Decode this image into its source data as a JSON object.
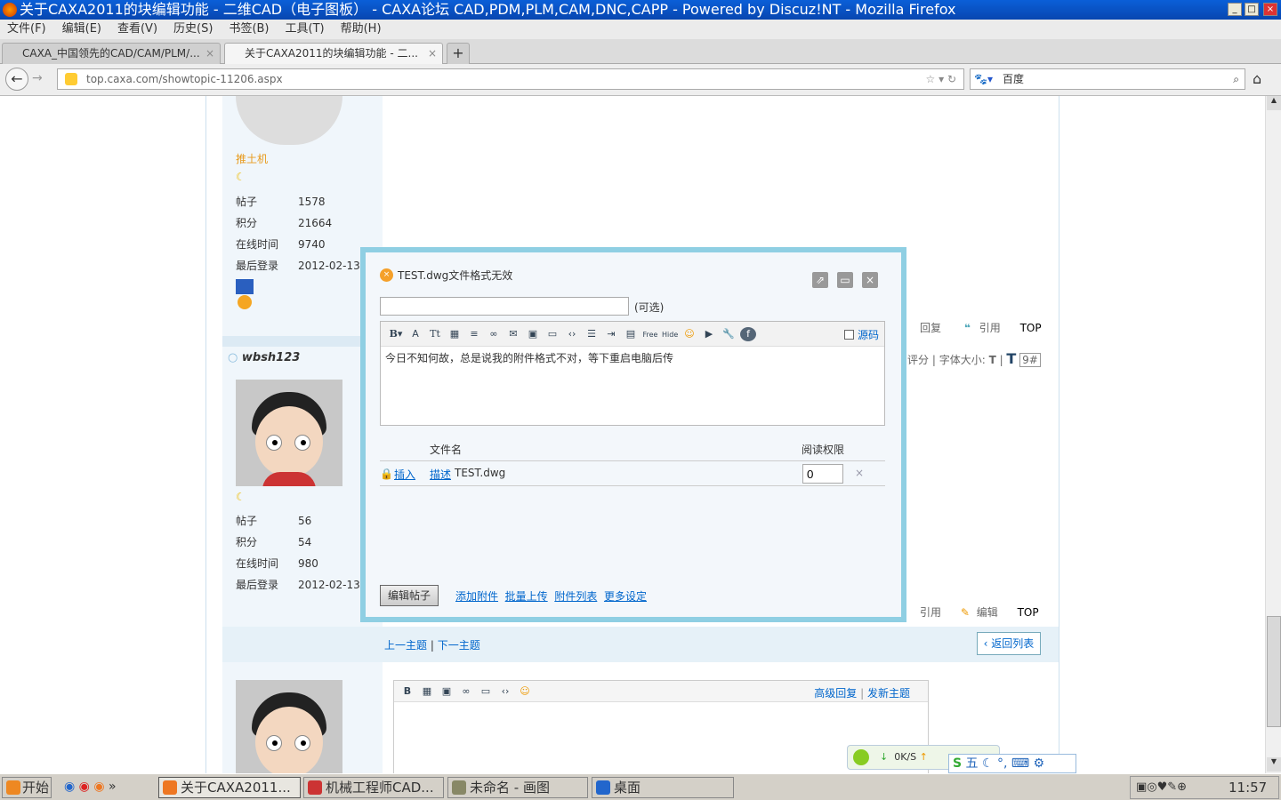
{
  "window": {
    "title": "关于CAXA2011的块编辑功能 - 二维CAD（电子图板） - CAXA论坛 CAD,PDM,PLM,CAM,DNC,CAPP - Powered by Discuz!NT - Mozilla Firefox",
    "min": "_",
    "max": "□",
    "close": "×"
  },
  "menu": [
    "文件(F)",
    "编辑(E)",
    "查看(V)",
    "历史(S)",
    "书签(B)",
    "工具(T)",
    "帮助(H)"
  ],
  "tabs": [
    {
      "label": "CAXA_中国领先的CAD/CAM/PLM/..."
    },
    {
      "label": "关于CAXA2011的块编辑功能 - 二..."
    }
  ],
  "new_tab": "+",
  "url": "top.caxa.com/showtopic-11206.aspx",
  "search_engine": "百度",
  "post1": {
    "user": "推土机",
    "stats": [
      {
        "label": "帖子",
        "value": "1578"
      },
      {
        "label": "积分",
        "value": "21664"
      },
      {
        "label": "在线时间",
        "value": "9740"
      },
      {
        "label": "最后登录",
        "value": "2012-02-13"
      }
    ],
    "actions": [
      "回复",
      "引用",
      "TOP"
    ]
  },
  "post2": {
    "user": "wbsh123",
    "bar": [
      "评分",
      "字体大小:",
      "T",
      "T",
      "9#"
    ],
    "stats": [
      {
        "label": "帖子",
        "value": "56"
      },
      {
        "label": "积分",
        "value": "54"
      },
      {
        "label": "在线时间",
        "value": "980"
      },
      {
        "label": "最后登录",
        "value": "2012-02-13"
      }
    ],
    "actions": [
      "引用",
      "编辑",
      "TOP"
    ]
  },
  "topic_nav": {
    "prev": "上一主题",
    "sep": "|",
    "next": "下一主题",
    "back": "返回列表"
  },
  "quick_reply": {
    "advanced": "高级回复",
    "sep": "|",
    "new_topic": "发新主题"
  },
  "dialog": {
    "title": "TEST.dwg文件格式无效",
    "title_placeholder": "",
    "optional": "(可选)",
    "source_label": "源码",
    "content": "今日不知何故，总是说我的附件格式不对，等下重启电脑后传",
    "col_filename": "文件名",
    "col_permission": "阅读权限",
    "attachment": {
      "insert": "插入",
      "describe": "描述",
      "filename": "TEST.dwg",
      "permission": "0",
      "remove": "×"
    },
    "submit": "编辑帖子",
    "links": [
      "添加附件",
      "批量上传",
      "附件列表",
      "更多设定"
    ]
  },
  "download_widget": {
    "speed": "0K/S"
  },
  "ime": {
    "mode": "五"
  },
  "taskbar": {
    "start": "开始",
    "more": "»",
    "tasks": [
      "关于CAXA2011...",
      "机械工程师CAD...",
      "未命名 - 画图",
      "桌面"
    ],
    "clock": "11:57"
  }
}
